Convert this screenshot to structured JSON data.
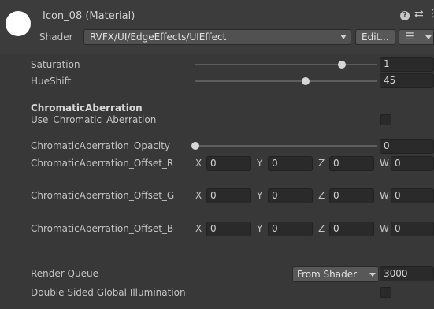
{
  "header": {
    "title": "Icon_08 (Material)",
    "help_icon": "?",
    "presets_icon": "⇄",
    "more_icon": "⋮",
    "shader_label": "Shader",
    "shader_value": "RVFX/UI/EdgeEffects/UIEffect",
    "edit_label": "Edit...",
    "list_icon": "☰"
  },
  "properties": {
    "saturation": {
      "label": "Saturation",
      "value": "1",
      "level": 0.81
    },
    "hueshift": {
      "label": "HueShift",
      "value": "45",
      "level": 0.61
    },
    "chromatic_header": "ChromaticAberration",
    "use_chromatic": {
      "label": "Use_Chromatic_Aberration",
      "checked": false
    },
    "opacity": {
      "label": "ChromaticAberration_Opacity",
      "value": "0",
      "level": 0.0
    },
    "offset_r": {
      "label": "ChromaticAberration_Offset_R",
      "x": "0",
      "y": "0",
      "z": "0",
      "w": "0"
    },
    "offset_g": {
      "label": "ChromaticAberration_Offset_G",
      "x": "0",
      "y": "0",
      "z": "0",
      "w": "0"
    },
    "offset_b": {
      "label": "ChromaticAberration_Offset_B",
      "x": "0",
      "y": "0",
      "z": "0",
      "w": "0"
    },
    "axes": {
      "x": "X",
      "y": "Y",
      "z": "Z",
      "w": "W"
    }
  },
  "footer": {
    "render_queue_label": "Render Queue",
    "render_queue_mode": "From Shader",
    "render_queue_value": "3000",
    "double_sided_label": "Double Sided Global Illumination",
    "double_sided_checked": false
  }
}
